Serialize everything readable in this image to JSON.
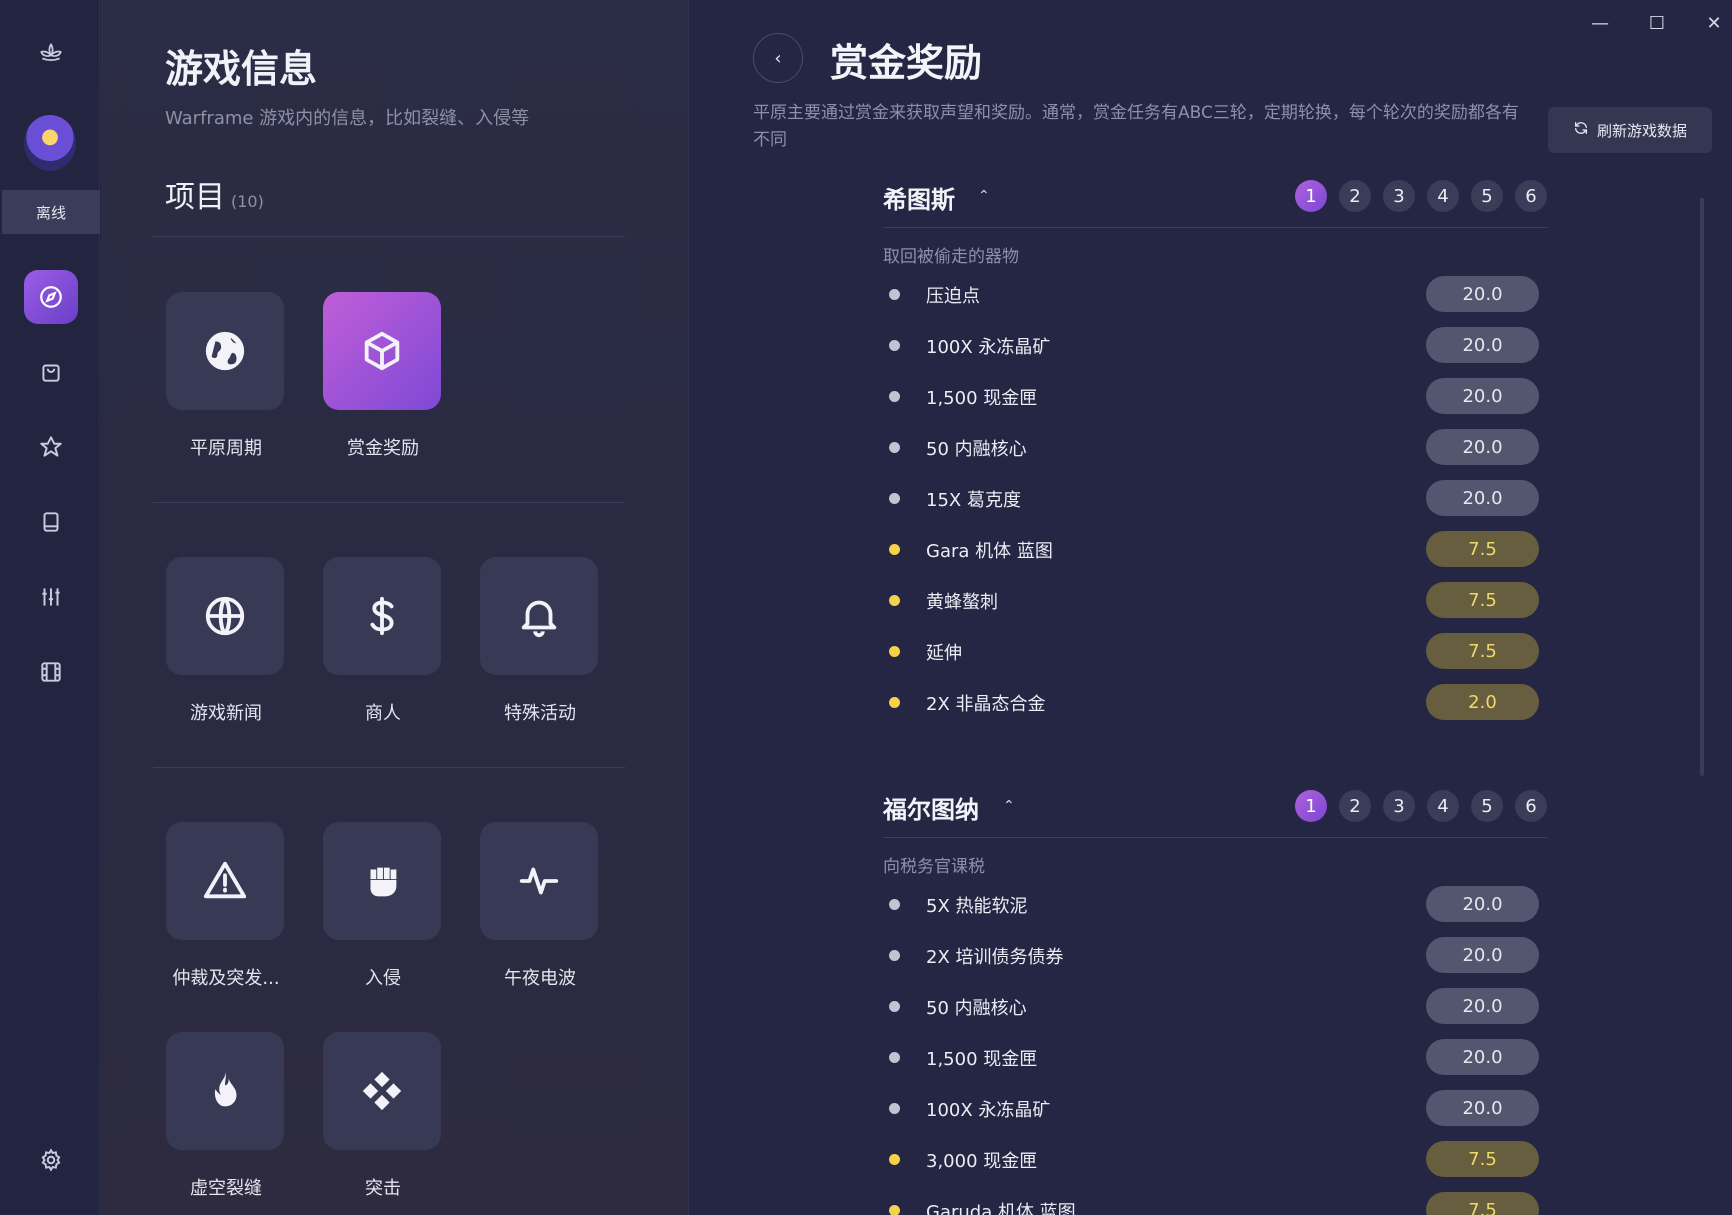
{
  "rail": {
    "status": "离线",
    "items": [
      {
        "icon": "lotus-icon"
      },
      {
        "icon": "compass-icon",
        "active": true
      },
      {
        "icon": "bag-icon"
      },
      {
        "icon": "star-emblem-icon"
      },
      {
        "icon": "book-icon"
      },
      {
        "icon": "sliders-icon"
      },
      {
        "icon": "film-icon"
      },
      {
        "icon": "gear-icon"
      }
    ]
  },
  "middle": {
    "title": "游戏信息",
    "subtitle": "Warframe 游戏内的信息，比如裂缝、入侵等",
    "section_label": "项目",
    "section_count": "(10)",
    "tiles": [
      {
        "label": "平原周期",
        "icon": "globe-solid-icon"
      },
      {
        "label": "赏金奖励",
        "icon": "cube-icon",
        "active": true
      },
      {
        "label": "游戏新闻",
        "icon": "globe-outline-icon"
      },
      {
        "label": "商人",
        "icon": "dollar-icon"
      },
      {
        "label": "特殊活动",
        "icon": "bell-icon"
      },
      {
        "label": "仲裁及突发...",
        "icon": "warning-icon"
      },
      {
        "label": "入侵",
        "icon": "fist-icon"
      },
      {
        "label": "午夜电波",
        "icon": "pulse-icon"
      },
      {
        "label": "虚空裂缝",
        "icon": "flame-icon"
      },
      {
        "label": "突击",
        "icon": "strike-icon"
      }
    ]
  },
  "right": {
    "back_label": "‹",
    "title": "赏金奖励",
    "description": "平原主要通过赏金来获取声望和奖励。通常，赏金任务有ABC三轮，定期轮换，每个轮次的奖励都各有不同",
    "refresh_label": "刷新游戏数据",
    "window_controls": {
      "minimize": "—",
      "maximize": "☐",
      "close": "✕"
    },
    "zones": [
      {
        "name": "希图斯",
        "chevron": "⌃",
        "pages": [
          "1",
          "2",
          "3",
          "4",
          "5",
          "6"
        ],
        "active_page": "1",
        "task": "取回被偷走的器物",
        "rewards": [
          {
            "name": "压迫点",
            "chance": "20.0",
            "rare": false
          },
          {
            "name": "100X 永冻晶矿",
            "chance": "20.0",
            "rare": false
          },
          {
            "name": "1,500 现金匣",
            "chance": "20.0",
            "rare": false
          },
          {
            "name": "50 内融核心",
            "chance": "20.0",
            "rare": false
          },
          {
            "name": "15X 葛克度",
            "chance": "20.0",
            "rare": false
          },
          {
            "name": "Gara 机体 蓝图",
            "chance": "7.5",
            "rare": true
          },
          {
            "name": "黄蜂螯刺",
            "chance": "7.5",
            "rare": true
          },
          {
            "name": "延伸",
            "chance": "7.5",
            "rare": true
          },
          {
            "name": "2X 非晶态合金",
            "chance": "2.0",
            "rare": true
          }
        ]
      },
      {
        "name": "福尔图纳",
        "chevron": "⌃",
        "pages": [
          "1",
          "2",
          "3",
          "4",
          "5",
          "6"
        ],
        "active_page": "1",
        "task": "向税务官课税",
        "rewards": [
          {
            "name": "5X 热能软泥",
            "chance": "20.0",
            "rare": false
          },
          {
            "name": "2X 培训债务债券",
            "chance": "20.0",
            "rare": false
          },
          {
            "name": "50 内融核心",
            "chance": "20.0",
            "rare": false
          },
          {
            "name": "1,500 现金匣",
            "chance": "20.0",
            "rare": false
          },
          {
            "name": "100X 永冻晶矿",
            "chance": "20.0",
            "rare": false
          },
          {
            "name": "3,000 现金匣",
            "chance": "7.5",
            "rare": true
          },
          {
            "name": "Garuda 机体 蓝图",
            "chance": "7.5",
            "rare": true
          }
        ]
      }
    ]
  }
}
